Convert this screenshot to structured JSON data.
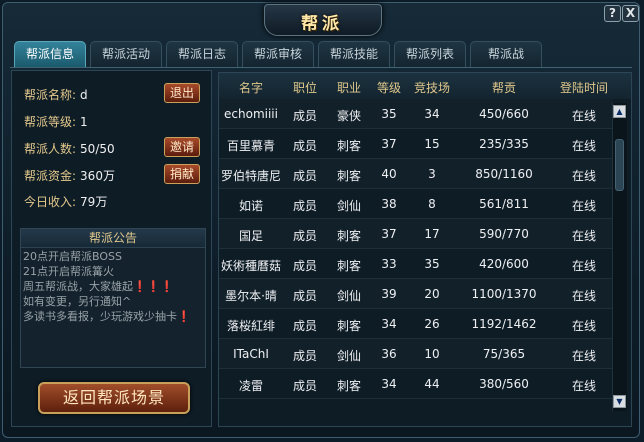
{
  "window": {
    "title": "帮派",
    "help_label": "?",
    "close_label": "X"
  },
  "tabs": [
    {
      "label": "帮派信息",
      "active": true
    },
    {
      "label": "帮派活动"
    },
    {
      "label": "帮派日志"
    },
    {
      "label": "帮派审核"
    },
    {
      "label": "帮派技能"
    },
    {
      "label": "帮派列表"
    },
    {
      "label": "帮派战"
    }
  ],
  "guild": {
    "name_label": "帮派名称:",
    "name_value": "d",
    "level_label": "帮派等级:",
    "level_value": "1",
    "members_label": "帮派人数:",
    "members_value": "50/50",
    "funds_label": "帮派资金:",
    "funds_value": "360万",
    "income_label": "今日收入:",
    "income_value": "79万",
    "quit_label": "退出",
    "invite_label": "邀请",
    "donate_label": "捐献"
  },
  "notice": {
    "title": "帮派公告",
    "lines": [
      "20点开启帮派BOSS",
      "21点开启帮派篝火",
      "周五帮派战，大家雄起❗❗❗",
      "如有变更，另行通知^",
      "多读书多看报，少玩游戏少抽卡❗"
    ]
  },
  "return_button": "返回帮派场景",
  "table": {
    "headers": [
      "名字",
      "职位",
      "职业",
      "等级",
      "竞技场",
      "帮贡",
      "登陆时间"
    ],
    "rows": [
      [
        "echomiiii",
        "成员",
        "豪侠",
        "35",
        "34",
        "450/660",
        "在线"
      ],
      [
        "百里慕青",
        "成员",
        "刺客",
        "37",
        "15",
        "235/335",
        "在线"
      ],
      [
        "罗伯特唐尼",
        "成员",
        "刺客",
        "40",
        "3",
        "850/1160",
        "在线"
      ],
      [
        "如诺",
        "成员",
        "剑仙",
        "38",
        "8",
        "561/811",
        "在线"
      ],
      [
        "国足",
        "成员",
        "刺客",
        "37",
        "17",
        "590/770",
        "在线"
      ],
      [
        "妖術種曆菇",
        "成员",
        "刺客",
        "33",
        "35",
        "420/600",
        "在线"
      ],
      [
        "墨尔本·晴",
        "成员",
        "剑仙",
        "39",
        "20",
        "1100/1370",
        "在线"
      ],
      [
        "落桜紅绯",
        "成员",
        "刺客",
        "34",
        "26",
        "1192/1462",
        "在线"
      ],
      [
        "ITaChI",
        "成员",
        "剑仙",
        "36",
        "10",
        "75/365",
        "在线"
      ],
      [
        "凌雷",
        "成员",
        "刺客",
        "34",
        "44",
        "380/560",
        "在线"
      ]
    ]
  },
  "scroll": {
    "up": "▲",
    "down": "▼"
  }
}
